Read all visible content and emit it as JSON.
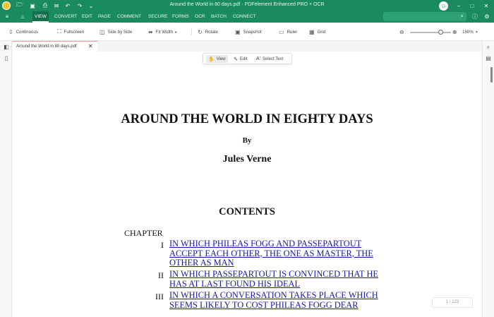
{
  "window": {
    "title": "Around the World in 80 days.pdf  ·  PDFelement Enhanced PRO + OCR"
  },
  "menu": {
    "items": [
      "VIEW",
      "CONVERT",
      "EDIT",
      "PAGE",
      "COMMENT",
      "SECURE",
      "FORMS",
      "OCR",
      "BATCH",
      "CONNECT"
    ],
    "active": "VIEW",
    "search_placeholder": ""
  },
  "toolbar": {
    "continuous": "Continuous",
    "fullscreen": "Fullscreen",
    "side_by_side": "Side by Side",
    "fit_width": "Fit Width",
    "rotate": "Rotate",
    "snapshot": "Snapshot",
    "ruler": "Ruler",
    "grid": "Grid",
    "zoom": "180%",
    "zoom_level": 0.75
  },
  "tab": {
    "label": "Around the World in 80 days.pdf"
  },
  "modes": {
    "view": "View",
    "edit": "Edit",
    "select_text": "Select Text"
  },
  "document": {
    "title": "AROUND THE WORLD IN EIGHTY DAYS",
    "by": "By",
    "author": "Jules Verne",
    "contents": "CONTENTS",
    "chapter_label": "CHAPTER",
    "chapters": [
      {
        "num": "I",
        "title": "IN WHICH PHILEAS FOGG AND PASSEPARTOUT ACCEPT EACH OTHER, THE ONE AS MASTER, THE OTHER AS MAN"
      },
      {
        "num": "II",
        "title": "IN WHICH PASSEPARTOUT IS CONVINCED THAT HE HAS AT LAST FOUND HIS IDEAL"
      },
      {
        "num": "III",
        "title": "IN WHICH A CONVERSATION TAKES PLACE WHICH SEEMS LIKELY TO COST PHILEAS FOGG DEAR"
      }
    ]
  },
  "pager": {
    "current": "1",
    "total": "/ 123"
  }
}
